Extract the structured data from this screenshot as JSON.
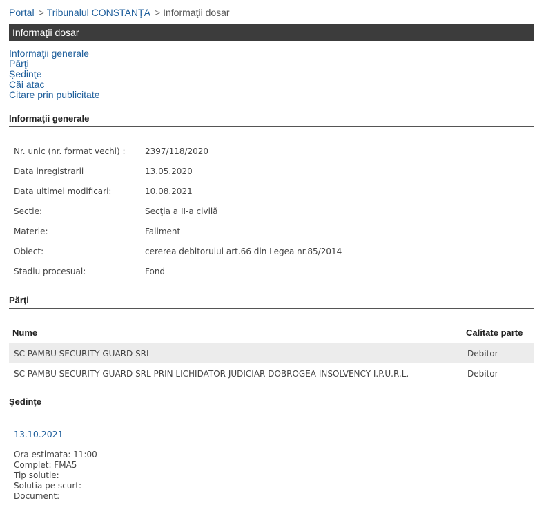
{
  "breadcrumb": {
    "items": [
      "Portal",
      "Tribunalul CONSTANŢA"
    ],
    "current": "Informaţii dosar",
    "separator": ">"
  },
  "title_bar": {
    "title": "Informaţii dosar"
  },
  "anchors": [
    "Informaţii generale",
    "Părţi",
    "Şedinţe",
    "Căi atac",
    "Citare prin publicitate"
  ],
  "sections": {
    "general": "Informaţii generale",
    "parti": "Părţi",
    "sedinte": "Şedinţe"
  },
  "info": [
    {
      "label": "Nr. unic (nr. format vechi) :",
      "value": "2397/118/2020"
    },
    {
      "label": "Data inregistrarii",
      "value": "13.05.2020"
    },
    {
      "label": "Data ultimei modificari:",
      "value": "10.08.2021"
    },
    {
      "label": "Sectie:",
      "value": "Secţia a II-a civilă"
    },
    {
      "label": "Materie:",
      "value": "Faliment"
    },
    {
      "label": "Obiect:",
      "value": "cererea debitorului art.66 din Legea nr.85/2014"
    },
    {
      "label": "Stadiu procesual:",
      "value": "Fond"
    }
  ],
  "parti": {
    "headers": {
      "name": "Nume",
      "role": "Calitate parte"
    },
    "rows": [
      {
        "name": "SC PAMBU SECURITY GUARD SRL",
        "role": "Debitor"
      },
      {
        "name": "SC PAMBU SECURITY GUARD SRL PRIN LICHIDATOR JUDICIAR DOBROGEA INSOLVENCY I.P.U.R.L.",
        "role": "Debitor"
      }
    ]
  },
  "sedinta": {
    "date": "13.10.2021",
    "details": [
      "Ora estimata: 11:00",
      "Complet: FMA5",
      "Tip solutie:",
      "Solutia pe scurt:",
      "Document:"
    ]
  },
  "colors": {
    "accent": "#1f5f9c",
    "title_bar_bg": "#3c3c3c",
    "row_shade": "#ececec"
  }
}
